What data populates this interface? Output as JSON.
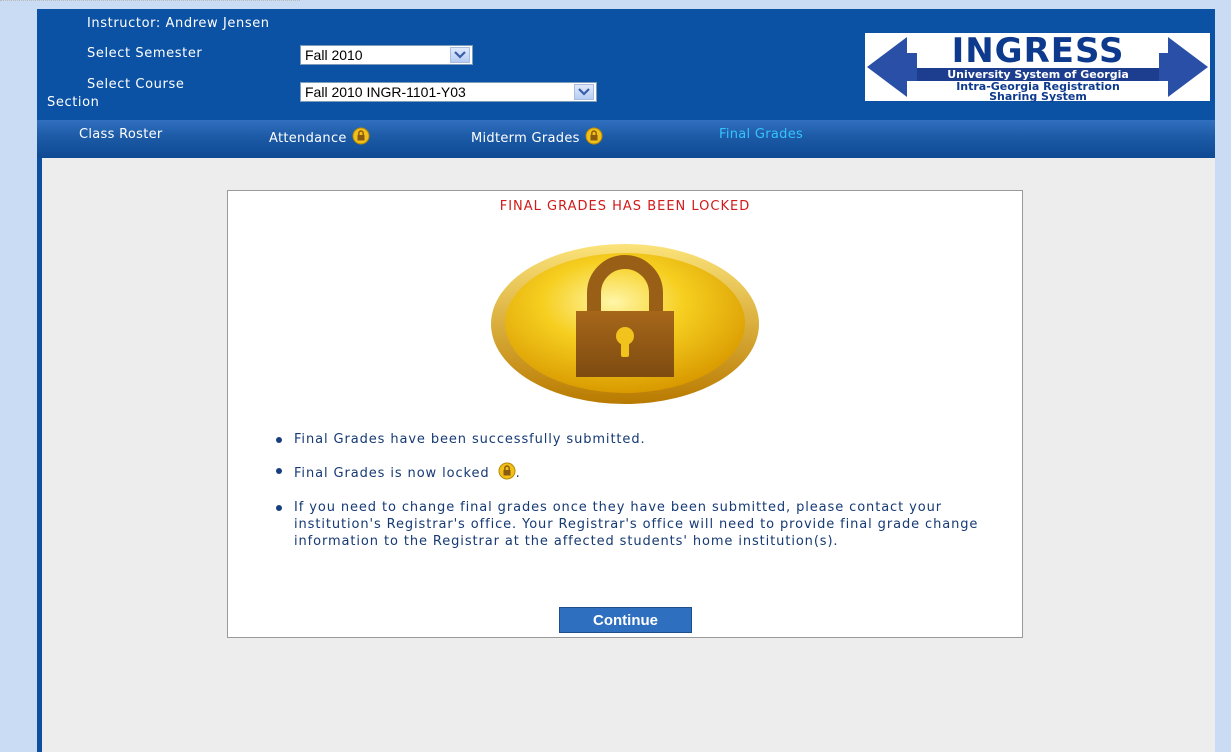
{
  "header": {
    "instructor": "Instructor: Andrew Jensen",
    "semester_label": "Select Semester",
    "semester_value": "Fall 2010",
    "course_label_line1": "Select Course",
    "course_label_line2": "Section",
    "course_value": "Fall 2010 INGR-1101-Y03"
  },
  "logo": {
    "title": "INGRESS",
    "line1": "University System of Georgia",
    "line2": "Intra-Georgia Registration",
    "line3": "Sharing System"
  },
  "nav": {
    "items": [
      {
        "label": "Class Roster",
        "locked": false,
        "active": false
      },
      {
        "label": "Attendance",
        "locked": true,
        "active": false
      },
      {
        "label": "Midterm Grades",
        "locked": true,
        "active": false
      },
      {
        "label": "Final Grades",
        "locked": false,
        "active": true
      }
    ]
  },
  "panel": {
    "title": "FINAL GRADES HAS BEEN LOCKED",
    "bullet1": "Final Grades have been successfully submitted.",
    "bullet2": "Final Grades is now locked",
    "bullet2_end": ".",
    "bullet3": "If you need to change final grades once they have been submitted, please contact your institution's Registrar's office. Your Registrar's office will need to provide final grade change information to the Registrar at the affected students' home institution(s).",
    "continue_label": "Continue"
  },
  "colors": {
    "header_bg": "#0b51a4",
    "title_red": "#d11a1a",
    "active_nav": "#35c3ff",
    "button_blue": "#2e6fbf"
  },
  "icons": [
    "lock-icon",
    "chevron-down-icon"
  ]
}
